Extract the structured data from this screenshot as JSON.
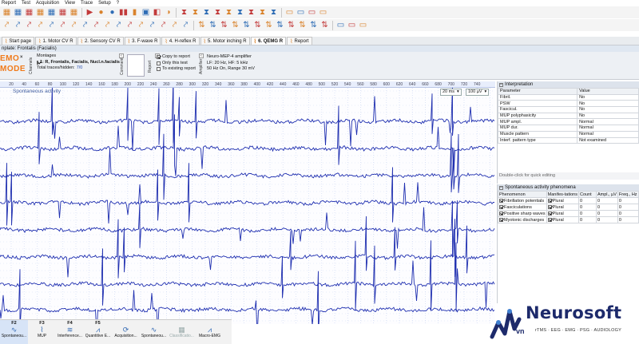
{
  "menu": [
    "Report",
    "Test",
    "Acquisition",
    "View",
    "Trace",
    "Setup",
    "?"
  ],
  "toolbar": {
    "row1": [
      "▦",
      "▦",
      "▦",
      "▦",
      "▦",
      "▦",
      "▦",
      "|",
      "▶",
      "●",
      "●",
      "▮▮",
      "▮",
      "▣",
      "◧",
      "◑",
      "|",
      "⧗",
      "⧗",
      "⧗",
      "⧗",
      "⧗",
      "⧗",
      "⧗",
      "⧗",
      "⧗",
      "|",
      "▭",
      "▭",
      "▭",
      "▭"
    ],
    "row2": [
      "⤤",
      "⤤",
      "⤤",
      "⤤",
      "⤤",
      "⤤",
      "⤤",
      "⤤",
      "⤤",
      "⤤",
      "⤤",
      "⤤",
      "⤤",
      "⤤",
      "⤤",
      "⤤",
      "⤤",
      "|",
      "⇅",
      "⇅",
      "⇅",
      "⇅",
      "⇅",
      "⇅",
      "⇅",
      "⇅",
      "⇅",
      "⇅",
      "⇅",
      "⇅",
      "|",
      "▭",
      "▭",
      "▭"
    ]
  },
  "tabs": [
    {
      "label": "Start page",
      "active": false
    },
    {
      "label": "1. Motor CV R",
      "active": false
    },
    {
      "label": "2. Sensory CV R",
      "active": false
    },
    {
      "label": "3. F-wave R",
      "active": false
    },
    {
      "label": "4. H-reflex R",
      "active": false
    },
    {
      "label": "5. Motor inching R",
      "active": false
    },
    {
      "label": "6. QEMG R",
      "active": true
    },
    {
      "label": "Report",
      "active": false
    }
  ],
  "subhead": "nplate: Frontalis (Facialis)",
  "demo": {
    "line1": "EMO",
    "line2": "MODE",
    "close": "×"
  },
  "channels_panel": {
    "side_label": "Channels",
    "title": "Montages",
    "item": "1: R, Frontalis, Facialis, Nucl.n.facialis",
    "total_label": "Total traces/hidden:",
    "total_value": "7/0"
  },
  "comment_panel": {
    "side_label": "Comment"
  },
  "report_panel": {
    "side_label": "Report",
    "copy_to_report": "Copy to report",
    "only_this_test": "Only this test",
    "to_existing_report": "To existing report"
  },
  "amplifier_panel": {
    "side_label": "Amplifier",
    "title": "Neuro-MEP-4 amplifier",
    "line2": "LF: 20 Hz, HF: 5 kHz",
    "line3": "50 Hz On, Range 30 mV"
  },
  "plot": {
    "label": "Spontaneous activity",
    "timebase": "20 ms",
    "sensitivity": "100 µV",
    "ruler_ticks": [
      "20",
      "40",
      "60",
      "80",
      "100",
      "120",
      "140",
      "160",
      "180",
      "200",
      "220",
      "240",
      "260",
      "280",
      "300",
      "320",
      "340",
      "360",
      "380",
      "400",
      "420",
      "440",
      "460",
      "480",
      "500",
      "520",
      "540",
      "560",
      "580",
      "600",
      "620",
      "640",
      "660",
      "680",
      "700",
      "720",
      "740"
    ],
    "trace_color": "#1f2fb0",
    "grid_color": "#c7d4f2"
  },
  "interpretation": {
    "title": "Interpretation",
    "headers": [
      "Parameter",
      "Value"
    ],
    "rows": [
      [
        "Fibril.",
        "No"
      ],
      [
        "PSW",
        "No"
      ],
      [
        "Fascicul.",
        "No"
      ],
      [
        "MUP polyphasicity",
        "No"
      ],
      [
        "MUP ampl.",
        "Normal"
      ],
      [
        "MUP dur.",
        "Normal"
      ],
      [
        "Muscle pattern",
        "Normal"
      ],
      [
        "Interf. pattern type",
        "Not examined"
      ]
    ],
    "hint": "Double-click for quick editing"
  },
  "spontaneous": {
    "title": "Spontaneous activity phenomena",
    "headers": [
      "Phenomenon",
      "Manifes-tations",
      "Count",
      "Ampl., µV",
      "Freq., Hz"
    ],
    "rows": [
      [
        "Fibrillation potentials",
        "Plural",
        "0",
        "0",
        "0"
      ],
      [
        "Fasciculations",
        "Plural",
        "0",
        "0",
        "0"
      ],
      [
        "Positive sharp waves",
        "Plural",
        "0",
        "0",
        "0"
      ],
      [
        "Myotonic discharges",
        "Plural",
        "0",
        "0",
        "0"
      ]
    ]
  },
  "fkeys": [
    {
      "key": "F2",
      "label": "Spontaneou...",
      "icon": "∿",
      "active": true,
      "dim": false
    },
    {
      "key": "F3",
      "label": "MUP",
      "icon": "⌇",
      "active": false,
      "dim": false
    },
    {
      "key": "F4",
      "label": "Interference...",
      "icon": "≋",
      "active": false,
      "dim": false
    },
    {
      "key": "F5",
      "label": "Quantitive E...",
      "icon": "⩘",
      "active": false,
      "dim": false
    },
    {
      "key": "",
      "label": "Acquisition...",
      "icon": "⟳",
      "active": false,
      "dim": false
    },
    {
      "key": "",
      "label": "Spontaneou...",
      "icon": "∿",
      "active": false,
      "dim": false
    },
    {
      "key": "",
      "label": "Classificatio...",
      "icon": "▦",
      "active": false,
      "dim": true
    },
    {
      "key": "",
      "label": "Macro-EMG",
      "icon": "⩘",
      "active": false,
      "dim": false
    }
  ],
  "logo": {
    "name": "Neurosoft",
    "sub": "vn",
    "tagline": "rTMS · EEG · EMG · PSG · AUDIOLOGY",
    "color": "#1d2a6b"
  }
}
